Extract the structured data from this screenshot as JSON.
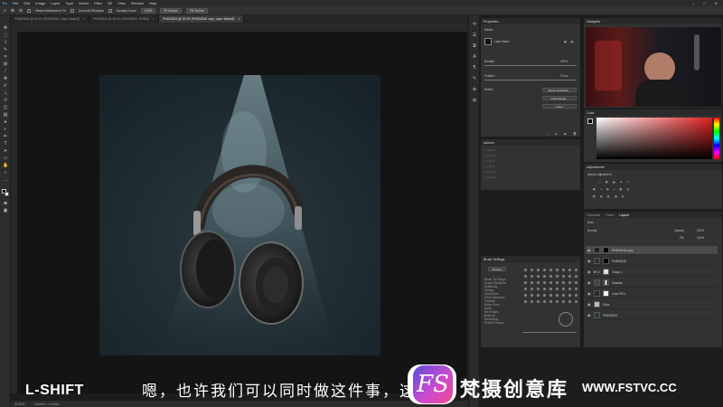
{
  "menu": [
    "Ps",
    "File",
    "Edit",
    "Image",
    "Layer",
    "Type",
    "Select",
    "Filter",
    "3D",
    "View",
    "Window",
    "Help"
  ],
  "options_bar": {
    "resize_label": "Resize Windows to Fit",
    "zoom_all_label": "Zoom All Windows",
    "scrubby_label": "Scrubby Zoom",
    "zoom_value": "100%",
    "fit_screen": "Fit Screen",
    "fill_screen": "Fill Screen"
  },
  "tabs": [
    {
      "label": "PHAS0516 @ 33.3% (PHAS0516, Layer Mask/8)",
      "active": false
    },
    {
      "label": "PHAS0523 @ 33.3% (PHAS0523, RGB/8)",
      "active": false
    },
    {
      "label": "PHAS0523-@ 33.3% (PHAS0516 copy, Layer Mask/8)",
      "active": true
    }
  ],
  "status": {
    "zoom": "33.33%",
    "info": "1 inches x 1 inches"
  },
  "properties": {
    "title": "Properties",
    "subtitle": "Masks",
    "mask_label": "Layer Mask",
    "density_label": "Density:",
    "density_value": "100%",
    "feather_label": "Feather:",
    "feather_value": "0.0 px",
    "refine_label": "Refine:",
    "select_mask": "Select and Mask...",
    "color_range": "Color Range...",
    "invert": "Invert"
  },
  "actions": {
    "title": "Actions"
  },
  "brush_settings": {
    "title": "Brush Settings",
    "brushes_btn": "Brushes",
    "options": [
      "Brush Tip Shape",
      "Shape Dynamics",
      "Scattering",
      "Texture",
      "Dual Brush",
      "Color Dynamics",
      "Transfer",
      "Brush Pose",
      "Noise",
      "Wet Edges",
      "Build-up",
      "Smoothing",
      "Protect Texture"
    ]
  },
  "navigator": {
    "title": "Navigator"
  },
  "color": {
    "title": "Color"
  },
  "adjustments": {
    "title": "Adjustments",
    "hint": "Add an adjustment"
  },
  "layers": {
    "tabs": [
      "Channels",
      "Paths",
      "Layers"
    ],
    "kind_label": "Kind",
    "blend": "Normal",
    "opacity_label": "Opacity:",
    "opacity": "100%",
    "fill_label": "Fill:",
    "fill": "100%",
    "items": [
      {
        "name": "PHAS0516 copy",
        "selected": true
      },
      {
        "name": "PHAS0516",
        "selected": false
      },
      {
        "name": "Group 1",
        "selected": false
      },
      {
        "name": "Shadow",
        "selected": false
      },
      {
        "name": "Color Fill 1",
        "selected": false
      },
      {
        "name": "Glow",
        "selected": false
      },
      {
        "name": "PHAS0523",
        "selected": false
      }
    ]
  },
  "overlay": {
    "channel": "L-SHIFT",
    "subtitle": "嗯，也许我们可以同时做这件事，这",
    "logo_text": "FS",
    "brand_cn": "梵摄创意库",
    "brand_url": "WWW.FSTVC.CC"
  }
}
